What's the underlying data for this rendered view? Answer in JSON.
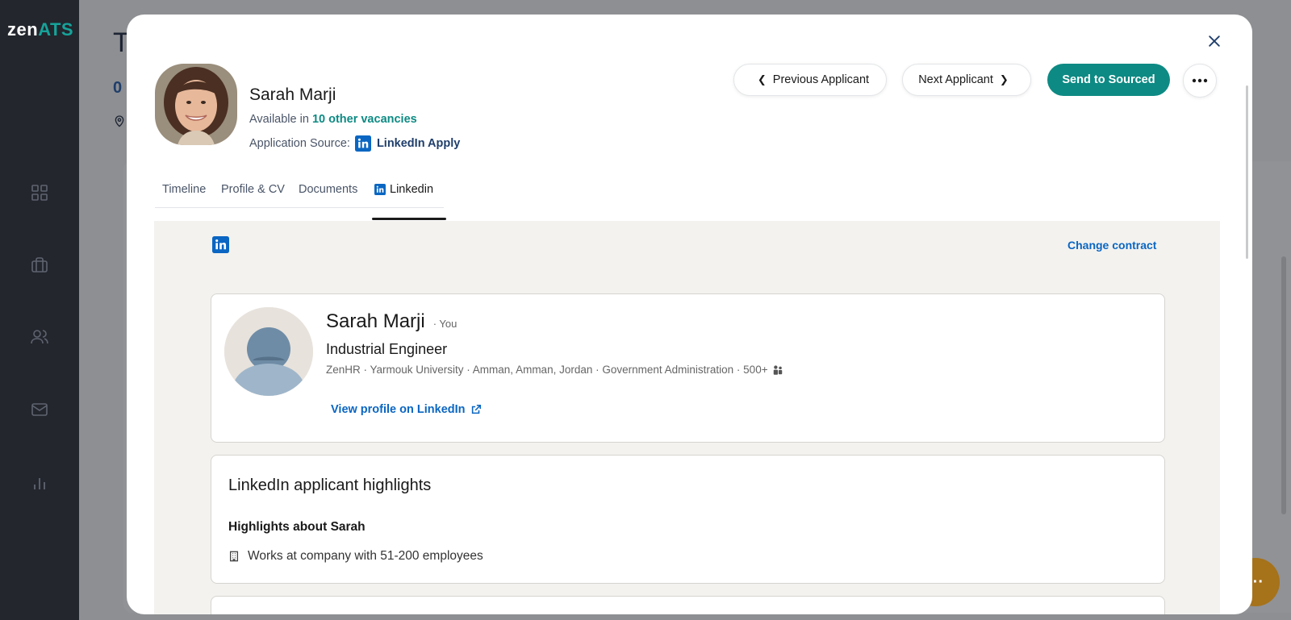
{
  "app": {
    "logo_primary": "zen",
    "logo_accent": "ATS",
    "brand_color": "#0d8a83"
  },
  "sidebar": {
    "items": [
      {
        "icon": "grid-icon"
      },
      {
        "icon": "briefcase-icon"
      },
      {
        "icon": "users-icon"
      },
      {
        "icon": "mail-icon"
      },
      {
        "icon": "bar-chart-icon"
      }
    ]
  },
  "background": {
    "title_partial": "T",
    "subtitle_partial": "0"
  },
  "modal": {
    "candidate": {
      "name": "Sarah Marji",
      "available_prefix": "Available in ",
      "available_link": "10 other vacancies",
      "source_label": "Application Source:",
      "source_value": "LinkedIn Apply"
    },
    "actions": {
      "previous": "Previous Applicant",
      "next": "Next Applicant",
      "send": "Send to Sourced",
      "more_icon": "more-horizontal-icon",
      "close_icon": "close-icon"
    },
    "tabs": [
      {
        "label": "Timeline",
        "active": false
      },
      {
        "label": "Profile & CV",
        "active": false
      },
      {
        "label": "Documents",
        "active": false
      },
      {
        "label": "Linkedin",
        "active": true
      }
    ],
    "linkedin": {
      "change_contract": "Change contract",
      "profile": {
        "name": "Sarah Marji",
        "you_tag": "· You",
        "headline": "Industrial Engineer",
        "meta": "ZenHR · Yarmouk University · Amman, Amman, Jordan · Government Administration · 500+",
        "view_profile": "View profile on LinkedIn"
      },
      "highlights": {
        "title": "LinkedIn applicant highlights",
        "subtitle": "Highlights about Sarah",
        "item": "Works at company with 51-200 employees"
      }
    }
  }
}
